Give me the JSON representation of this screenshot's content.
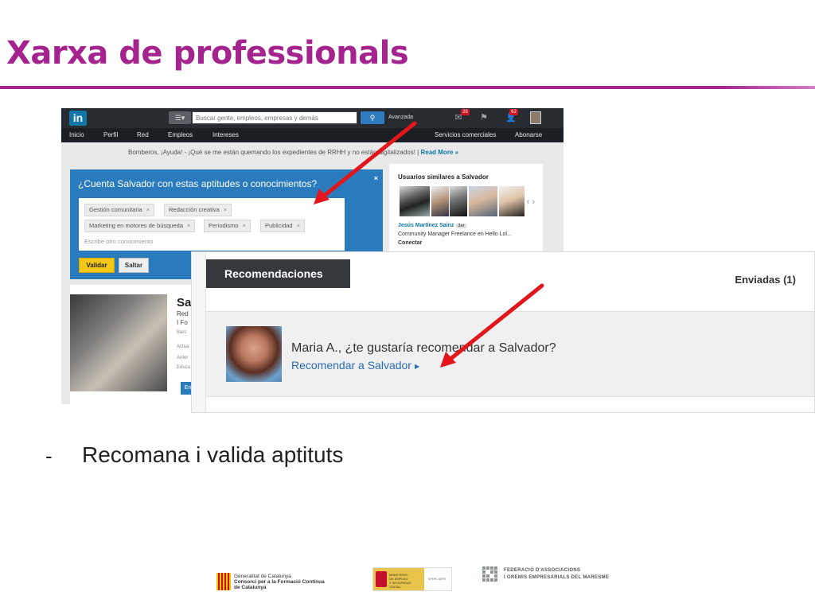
{
  "slide": {
    "title": "Xarxa de professionals",
    "bullet_marker": "-",
    "bullet_text": "Recomana i valida aptituts",
    "accent_color": "#a4238f"
  },
  "linkedin": {
    "logo": "in",
    "search_placeholder": "Buscar gente, empleos, empresas y demás",
    "advanced_label": "Avanzada",
    "badges": {
      "messages": "26",
      "notifications": "62"
    },
    "nav_left": [
      "Inicio",
      "Perfil",
      "Red",
      "Empleos",
      "Intereses"
    ],
    "nav_right": [
      "Servicios comerciales",
      "Abonarse"
    ],
    "banner_text": "Bomberos, ¡Ayuda! - ¡Qué se me están quemando los expedientes de RRHH y no están digitalizados! |",
    "banner_link": "Read More »",
    "skills": {
      "title": "¿Cuenta Salvador con estas aptitudes o conocimientos?",
      "close": "×",
      "chips": [
        "Gestión comunitaria",
        "Redacción creativa",
        "Marketing en motores de búsqueda",
        "Periodismo",
        "Publicidad"
      ],
      "chip_remove": "×",
      "input_placeholder": "Escribe otro conocimiento",
      "validate_label": "Validar",
      "skip_label": "Saltar"
    },
    "similar": {
      "title": "Usuarios similares a Salvador",
      "name": "Jesús Martínez Sainz",
      "degree": "3er",
      "description": "Community Manager Freelance en Hello Lol...",
      "connect": "Conectar",
      "chevrons": "‹ ›"
    },
    "profile": {
      "name": "Sa",
      "line1": "Red",
      "line2": "I Fo",
      "line3": "Barc",
      "meta": [
        "Actua",
        "Anter",
        "Educa"
      ],
      "button": "En"
    }
  },
  "recommendations": {
    "tab_label": "Recomendaciones",
    "sent_label": "Enviadas (1)",
    "question": "Maria A., ¿te gustaría recomendar a Salvador?",
    "link": "Recomendar a Salvador"
  },
  "footer": {
    "generalitat": [
      "Generalitat de Catalunya",
      "Consorci per a la Formació Contínua",
      "de Catalunya"
    ],
    "ministry": [
      "MINISTERIO",
      "DE EMPLEO",
      "Y SEGURIDAD SOCIAL"
    ],
    "ministry_side": "SPEPE-SEPE",
    "federation": [
      "FEDERACIÓ D'ASSOCIACIONS",
      "I GREMIS EMPRESARIALS DEL MARESME"
    ]
  },
  "icons": {
    "arrow_color": "#e3161b",
    "linkedin_blue": "#0e76a8"
  }
}
